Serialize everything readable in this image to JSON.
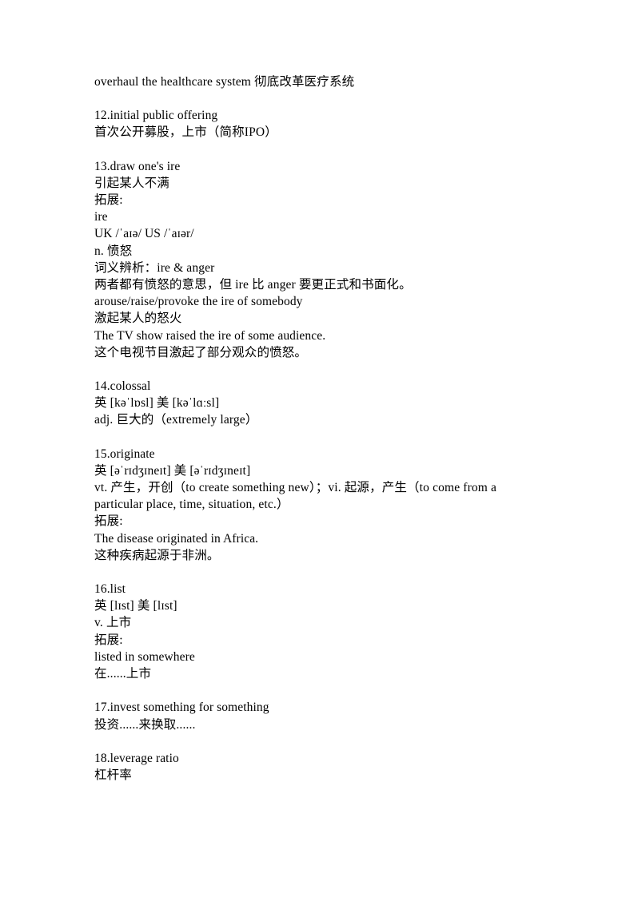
{
  "document": {
    "kind": "vocabulary-study-notes",
    "entries": [
      {
        "id": "entry-overhaul",
        "lines": [
          "overhaul the healthcare system 彻底改革医疗系统"
        ]
      },
      {
        "id": "entry-12-ipo",
        "lines": [
          "12.initial public offering",
          "首次公开募股，上市（简称IPO）"
        ]
      },
      {
        "id": "entry-13-ire",
        "lines": [
          "13.draw one's ire",
          "引起某人不满",
          "拓展:",
          "ire",
          "UK /ˈaɪə/ US /ˈaɪər/",
          "n. 愤怒",
          "词义辨析：ire & anger",
          "两者都有愤怒的意思，但 ire 比 anger 要更正式和书面化。",
          "arouse/raise/provoke the ire of somebody",
          "激起某人的怒火",
          "The TV show raised the ire of some audience.",
          "这个电视节目激起了部分观众的愤怒。"
        ]
      },
      {
        "id": "entry-14-colossal",
        "lines": [
          "14.colossal",
          "英 [kəˈlɒsl] 美 [kəˈlɑːsl]",
          "adj. 巨大的（extremely large）"
        ]
      },
      {
        "id": "entry-15-originate",
        "lines": [
          "15.originate",
          "英 [əˈrɪdʒɪneɪt] 美 [əˈrɪdʒɪneɪt]",
          "vt. 产生，开创（to create something new）；vi. 起源，产生（to come from a particular place, time, situation, etc.）",
          "拓展:",
          "The disease originated in Africa.",
          "这种疾病起源于非洲。"
        ]
      },
      {
        "id": "entry-16-list",
        "lines": [
          "16.list",
          "英 [lɪst] 美 [lɪst]",
          "v. 上市",
          "拓展:",
          "listed in somewhere",
          "在......上市"
        ]
      },
      {
        "id": "entry-17-invest",
        "lines": [
          "17.invest something for something",
          "投资......来换取......"
        ]
      },
      {
        "id": "entry-18-leverage",
        "lines": [
          "18.leverage ratio",
          "杠杆率"
        ]
      }
    ]
  }
}
